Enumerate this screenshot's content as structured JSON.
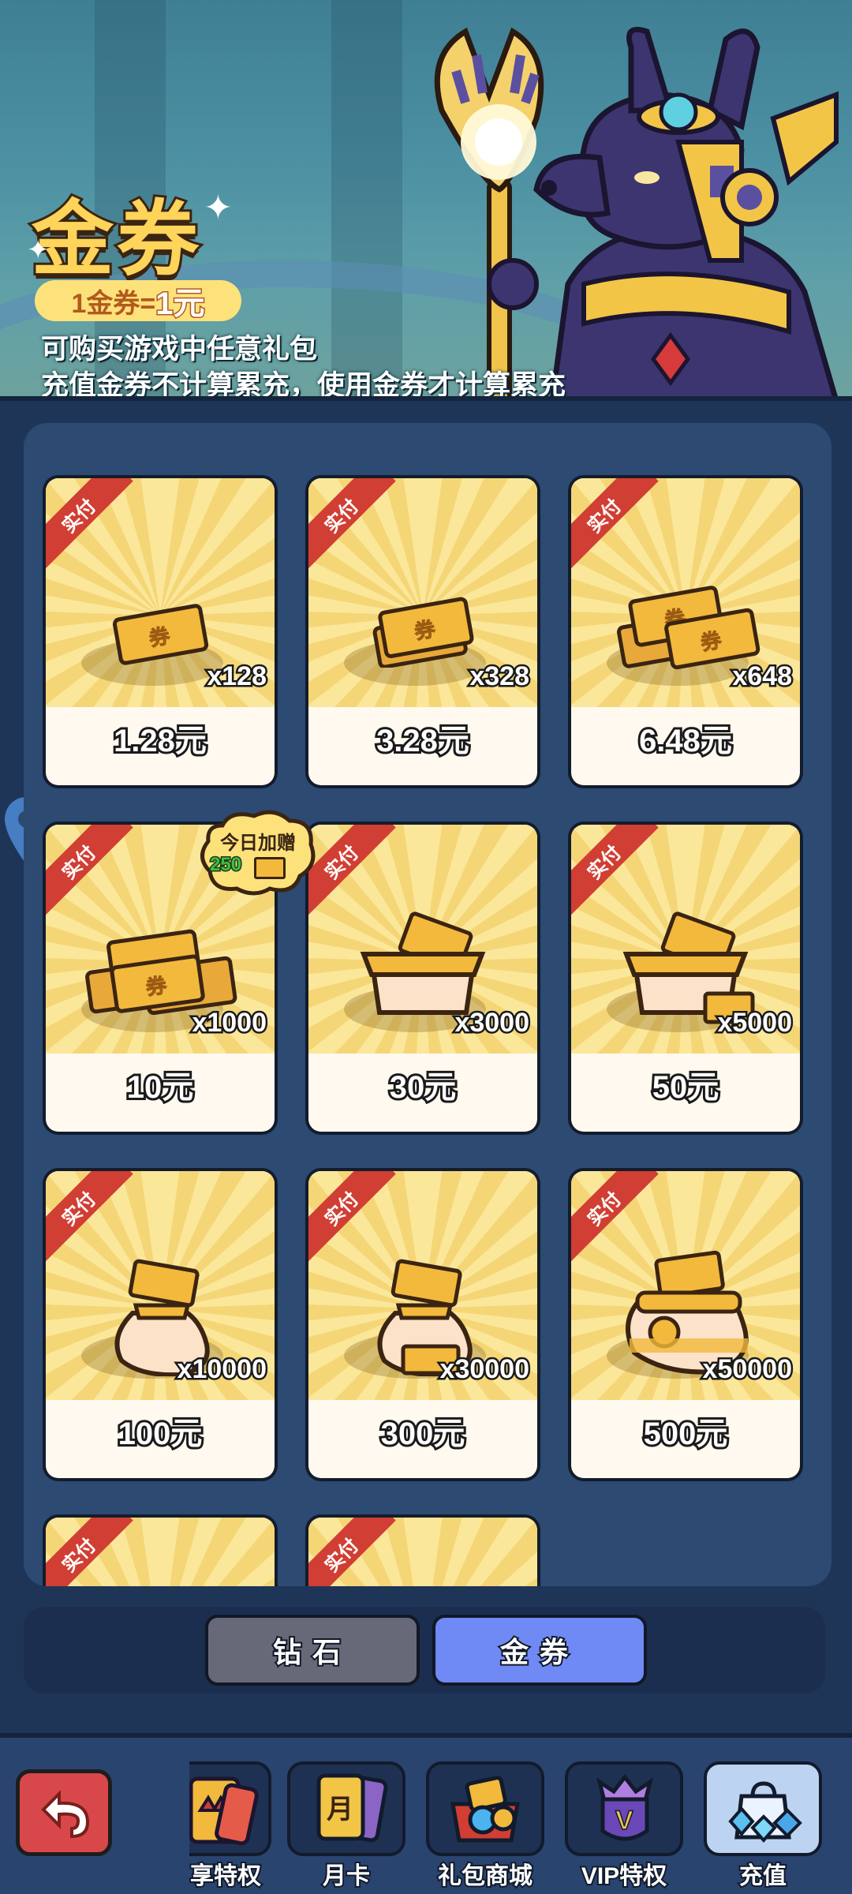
{
  "header": {
    "title": "金券",
    "rate_prefix": "1金券=",
    "rate_value": "1元",
    "desc_line1": "可购买游戏中任意礼包",
    "desc_line2": "充值金券不计算累充，使用金券才计算累充"
  },
  "corner_label": "实付",
  "bonus": {
    "label": "今日加赠",
    "amount": "250"
  },
  "cards": [
    {
      "qty": "x128",
      "price": "1.28元"
    },
    {
      "qty": "x328",
      "price": "3.28元"
    },
    {
      "qty": "x648",
      "price": "6.48元"
    },
    {
      "qty": "x1000",
      "price": "10元"
    },
    {
      "qty": "x3000",
      "price": "30元"
    },
    {
      "qty": "x5000",
      "price": "50元"
    },
    {
      "qty": "x10000",
      "price": "100元"
    },
    {
      "qty": "x30000",
      "price": "300元"
    },
    {
      "qty": "x50000",
      "price": "500元"
    }
  ],
  "tabs": {
    "diamond": "钻石",
    "coupon": "金券"
  },
  "nav": {
    "items": [
      "享特权",
      "月卡",
      "礼包商城",
      "VIP特权",
      "充值"
    ],
    "monthly_icon_text": "月"
  },
  "colors": {
    "accent": "#6f89f5",
    "tab_inactive": "#676878",
    "gold": "#ffd45a",
    "ribbon": "#d13e33"
  }
}
